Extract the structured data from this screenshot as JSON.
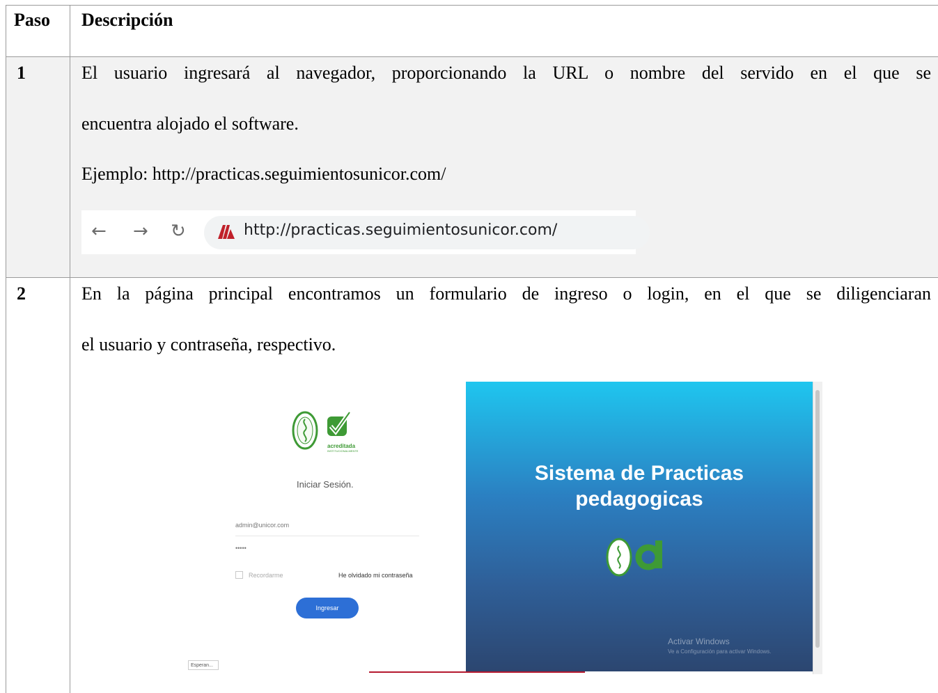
{
  "table": {
    "headers": {
      "step": "Paso",
      "description": "Descripción"
    },
    "rows": [
      {
        "step": "1",
        "line1": "El usuario ingresará al navegador, proporcionando la URL o nombre del servido en el que se",
        "line2": "encuentra alojado el software.",
        "example": "Ejemplo: http://practicas.seguimientosunicor.com/"
      },
      {
        "step": "2",
        "line1": "En la página principal encontramos un formulario de ingreso o login, en el que se diligenciaran",
        "line2": "el usuario y contraseña, respectivo."
      }
    ]
  },
  "browser_bar": {
    "url": "http://practicas.seguimientosunicor.com/",
    "icons": [
      "back-arrow-icon",
      "forward-arrow-icon",
      "reload-icon",
      "site-favicon"
    ],
    "favicon_color": "#c0202a"
  },
  "login_screenshot": {
    "logo_text": "acreditada",
    "logo_subtext": "INSTITUCIONALMENTE",
    "form_title": "Iniciar Sesión.",
    "email_value": "admin@unicor.com",
    "password_value": "•••••",
    "remember_label": "Recordarme",
    "forgot_link": "He olvidado mi contraseña",
    "submit_label": "Ingresar",
    "status_text": "Esperan...",
    "panel_title_line1": "Sistema de Practicas",
    "panel_title_line2": "pedagogicas",
    "watermark_title": "Activar Windows",
    "watermark_sub": "Ve a Configuración para activar Windows.",
    "accent_color": "#2d6fd6",
    "check_color": "#3e9a35"
  }
}
